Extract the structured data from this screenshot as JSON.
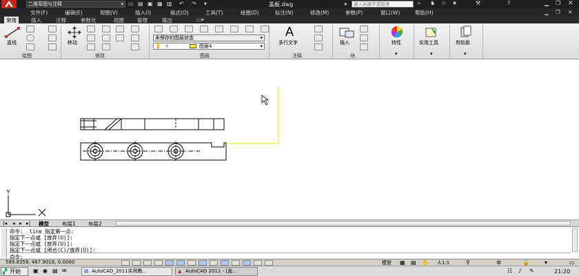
{
  "titlebar": {
    "workspace": "二维草图与注释",
    "doc_title": "盖板.dwg",
    "search_placeholder": "键入关键字或短语"
  },
  "menu": [
    "文件(F)",
    "编辑(E)",
    "视图(V)",
    "插入(I)",
    "格式(O)",
    "工具(T)",
    "绘图(D)",
    "标注(N)",
    "修改(M)",
    "参数(P)",
    "窗口(W)",
    "帮助(H)"
  ],
  "tabs": [
    "常用",
    "插入",
    "注释",
    "参数化",
    "视图",
    "管理",
    "输出"
  ],
  "ribbon": {
    "line_label": "直线",
    "move_label": "移动",
    "draw_panel": "绘图",
    "modify_panel": "修改",
    "layer_panel": "图层",
    "layer_state": "未保存的图层状态",
    "layer_name": "图层4",
    "mtext_label": "多行文字",
    "annotation_panel": "注释",
    "insert_label": "插入",
    "block_panel": "块",
    "properties_label": "特性",
    "utilities_label": "实用工具",
    "clipboard_label": "剪贴板"
  },
  "layout_tabs": [
    "模型",
    "布局1",
    "布局2"
  ],
  "command": {
    "lines": [
      "命令: _line 指定第一点:",
      "指定下一点或 [放弃(U)]:",
      "指定下一点或 [放弃(U)]:",
      "指定下一点或 [闭合(C)/放弃(U)]:"
    ],
    "prompt": "命令:"
  },
  "status": {
    "coords": "589.8359, 487.9018, 0.0000",
    "model": "模型",
    "scale": "人1:1"
  },
  "taskbar": {
    "start": "开始",
    "task1": "AutoCAD_2011实例教...",
    "task2": "AutoCAD 2011 - [盖...",
    "clock": "21:20"
  },
  "colors": {
    "accent_red": "#c0281e",
    "layer_yellow": "#ffff00"
  }
}
